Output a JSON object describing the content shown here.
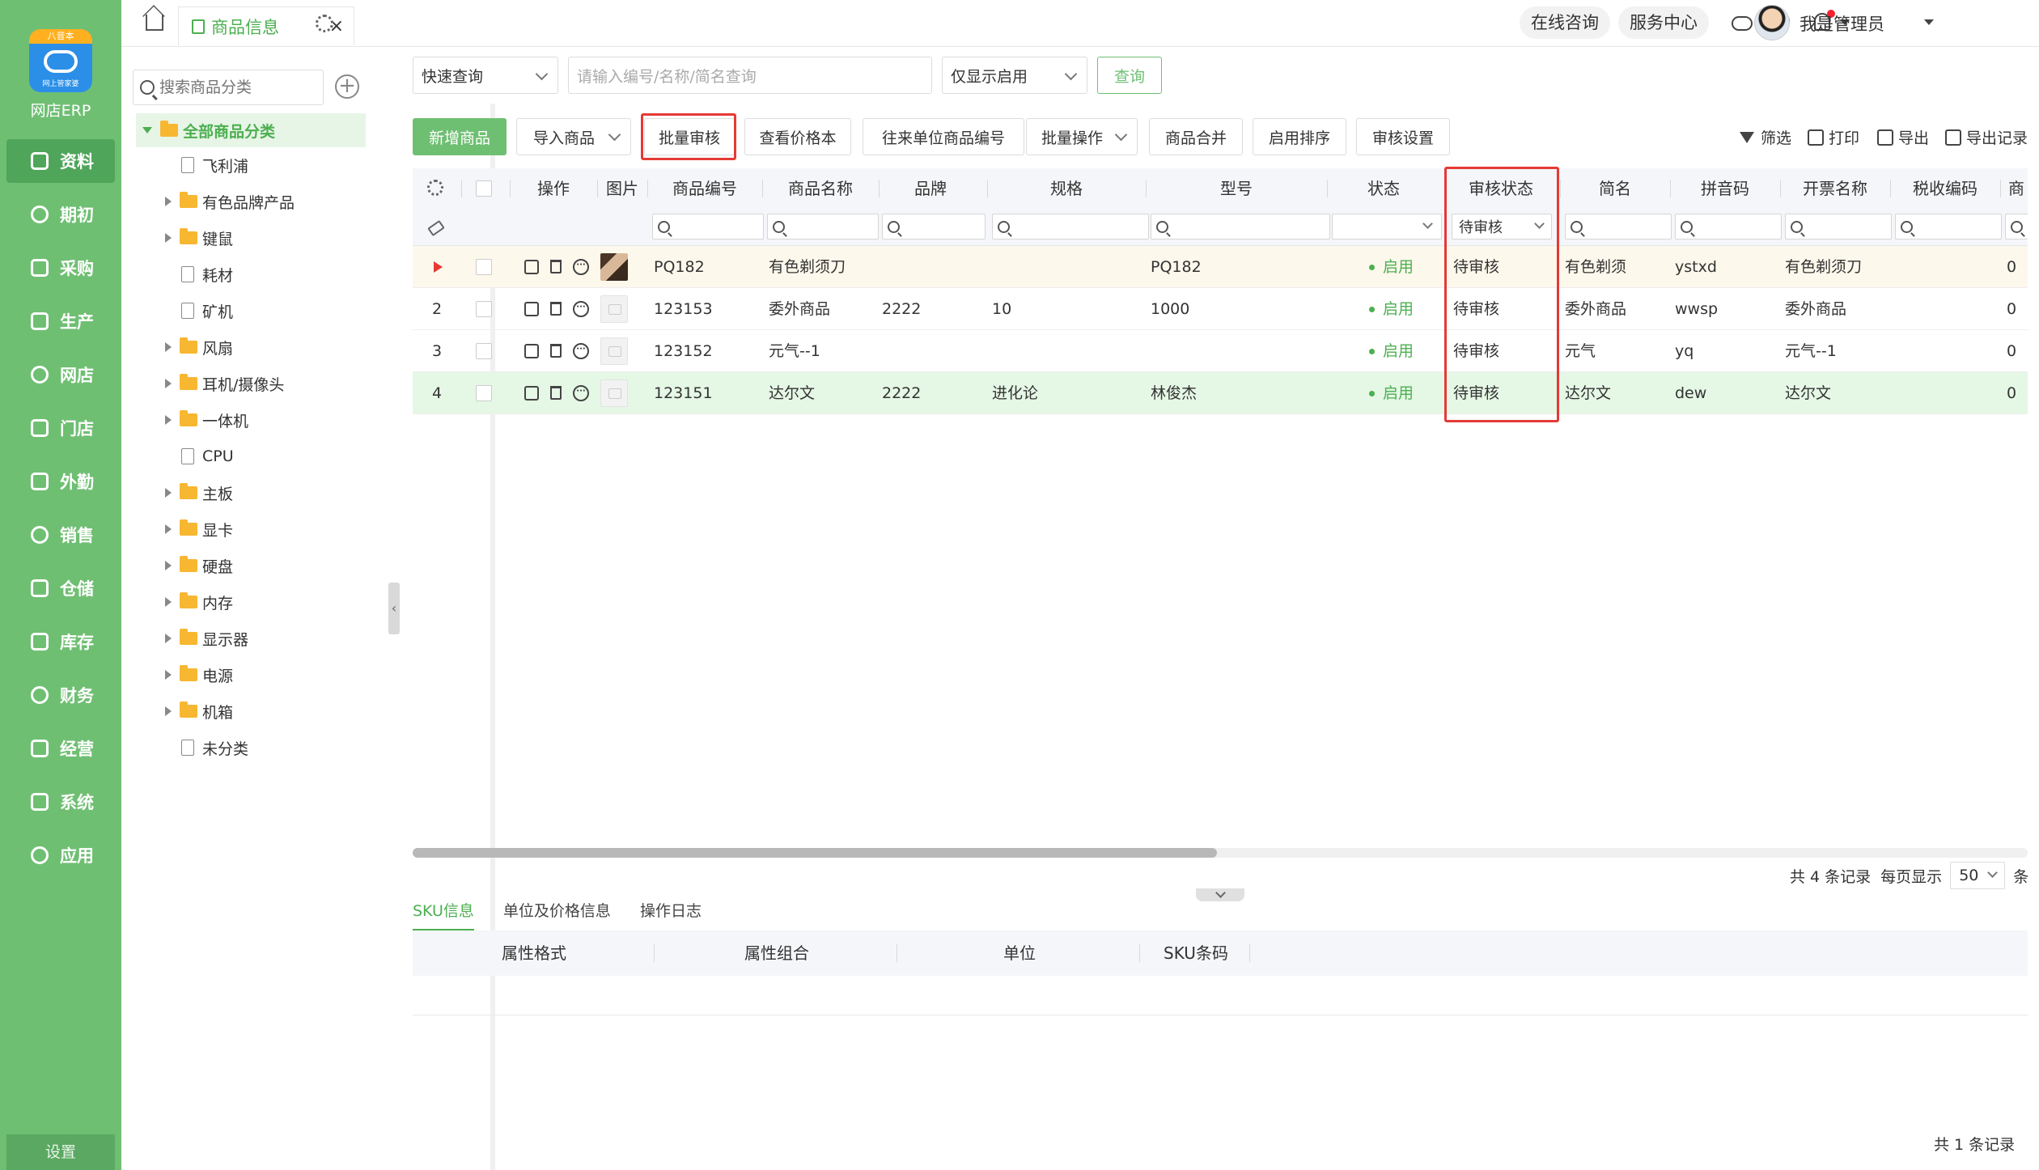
{
  "app": {
    "logo_badge": "八音本",
    "logo_sub": "网上管家婆",
    "name": "网店ERP",
    "settings": "设置"
  },
  "nav": [
    {
      "label": "资料",
      "icon": "document-icon",
      "active": true
    },
    {
      "label": "期初",
      "icon": "target-icon",
      "active": false
    },
    {
      "label": "采购",
      "icon": "purchase-icon",
      "active": false
    },
    {
      "label": "生产",
      "icon": "production-icon",
      "active": false
    },
    {
      "label": "网店",
      "icon": "store-icon",
      "active": false
    },
    {
      "label": "门店",
      "icon": "shop-pie-icon",
      "active": false
    },
    {
      "label": "外勤",
      "icon": "field-target-icon",
      "active": false
    },
    {
      "label": "销售",
      "icon": "sales-icon",
      "active": false
    },
    {
      "label": "仓储",
      "icon": "warehouse-icon",
      "active": false
    },
    {
      "label": "库存",
      "icon": "inventory-icon",
      "active": false
    },
    {
      "label": "财务",
      "icon": "finance-icon",
      "active": false
    },
    {
      "label": "经营",
      "icon": "chart-icon",
      "active": false
    },
    {
      "label": "系统",
      "icon": "system-gear-icon",
      "active": false
    },
    {
      "label": "应用",
      "icon": "apps-plus-icon",
      "active": false
    }
  ],
  "topbar": {
    "tab_label": "商品信息",
    "tab_close": "×",
    "online_consult": "在线咨询",
    "service_center": "服务中心",
    "user_name": "我是管理员"
  },
  "categories": {
    "search_placeholder": "搜索商品分类",
    "add": "+",
    "root": "全部商品分类",
    "items": [
      {
        "label": "飞利浦",
        "type": "file"
      },
      {
        "label": "有色品牌产品",
        "type": "folder"
      },
      {
        "label": "键鼠",
        "type": "folder"
      },
      {
        "label": "耗材",
        "type": "file"
      },
      {
        "label": "矿机",
        "type": "file"
      },
      {
        "label": "风扇",
        "type": "folder"
      },
      {
        "label": "耳机/摄像头",
        "type": "folder"
      },
      {
        "label": "一体机",
        "type": "folder"
      },
      {
        "label": "CPU",
        "type": "file"
      },
      {
        "label": "主板",
        "type": "folder"
      },
      {
        "label": "显卡",
        "type": "folder"
      },
      {
        "label": "硬盘",
        "type": "folder"
      },
      {
        "label": "内存",
        "type": "folder"
      },
      {
        "label": "显示器",
        "type": "folder"
      },
      {
        "label": "电源",
        "type": "folder"
      },
      {
        "label": "机箱",
        "type": "folder"
      },
      {
        "label": "未分类",
        "type": "file"
      }
    ],
    "splitter": "‹"
  },
  "query": {
    "mode": "快速查询",
    "placeholder": "请输入编号/名称/简名查询",
    "filter": "仅显示启用",
    "submit": "查询"
  },
  "toolbar": {
    "new": "新增商品",
    "import": "导入商品",
    "batch_audit": "批量审核",
    "price_book": "查看价格本",
    "partner_code": "往来单位商品编号",
    "batch_ops": "批量操作",
    "merge": "商品合并",
    "sort": "启用排序",
    "audit_settings": "审核设置",
    "filter": "筛选",
    "print": "打印",
    "export": "导出",
    "export_log": "导出记录"
  },
  "table": {
    "headers": {
      "op": "操作",
      "img": "图片",
      "code": "商品编号",
      "name": "商品名称",
      "brand": "品牌",
      "spec": "规格",
      "model": "型号",
      "status": "状态",
      "audit": "审核状态",
      "short": "简名",
      "pinyin": "拼音码",
      "invoice": "开票名称",
      "tax": "税收编码",
      "more": "商"
    },
    "audit_filter_value": "待审核",
    "rows": [
      {
        "no": "",
        "code": "PQ182",
        "name": "有色剃须刀",
        "brand": "",
        "spec": "",
        "model": "PQ182",
        "status": "启用",
        "audit": "待审核",
        "short": "有色剃须",
        "pinyin": "ystxd",
        "invoice": "有色剃须刀",
        "tax": "",
        "last": "0",
        "img": "photo"
      },
      {
        "no": "2",
        "code": "123153",
        "name": "委外商品",
        "brand": "2222",
        "spec": "10",
        "model": "1000",
        "status": "启用",
        "audit": "待审核",
        "short": "委外商品",
        "pinyin": "wwsp",
        "invoice": "委外商品",
        "tax": "",
        "last": "0",
        "img": "empty"
      },
      {
        "no": "3",
        "code": "123152",
        "name": "元气--1",
        "brand": "",
        "spec": "",
        "model": "",
        "status": "启用",
        "audit": "待审核",
        "short": "元气",
        "pinyin": "yq",
        "invoice": "元气--1",
        "tax": "",
        "last": "0",
        "img": "empty"
      },
      {
        "no": "4",
        "code": "123151",
        "name": "达尔文",
        "brand": "2222",
        "spec": "进化论",
        "model": "林俊杰",
        "status": "启用",
        "audit": "待审核",
        "short": "达尔文",
        "pinyin": "dew",
        "invoice": "达尔文",
        "tax": "",
        "last": "0",
        "img": "empty"
      }
    ]
  },
  "pager": {
    "total": "共 4 条记录",
    "per_page_label": "每页显示",
    "per_page": "50",
    "unit": "条"
  },
  "detail": {
    "tabs": [
      "SKU信息",
      "单位及价格信息",
      "操作日志"
    ],
    "sku_headers": [
      "属性格式",
      "属性组合",
      "单位",
      "SKU条码"
    ],
    "count": "共 1 条记录"
  },
  "colors": {
    "nav_bg": "#6fbf73",
    "accent": "#4caf50",
    "highlight_border": "#e53935"
  }
}
